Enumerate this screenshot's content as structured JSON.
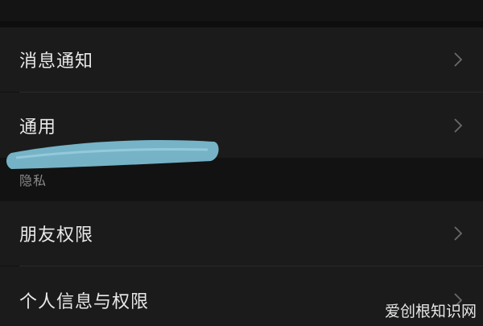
{
  "settings": {
    "items": [
      {
        "label": "消息通知"
      },
      {
        "label": "通用"
      },
      {
        "label": "朋友权限"
      },
      {
        "label": "个人信息与权限"
      }
    ],
    "section_privacy": "隐私"
  },
  "icons": {
    "chevron": "chevron-right-icon"
  },
  "colors": {
    "background": "#111111",
    "row": "#1b1b1b",
    "text": "#e9e9e9",
    "section_text": "#8a8a8a",
    "scribble": "#7ec0d6"
  },
  "watermark": {
    "text": "爱创根知识网"
  }
}
